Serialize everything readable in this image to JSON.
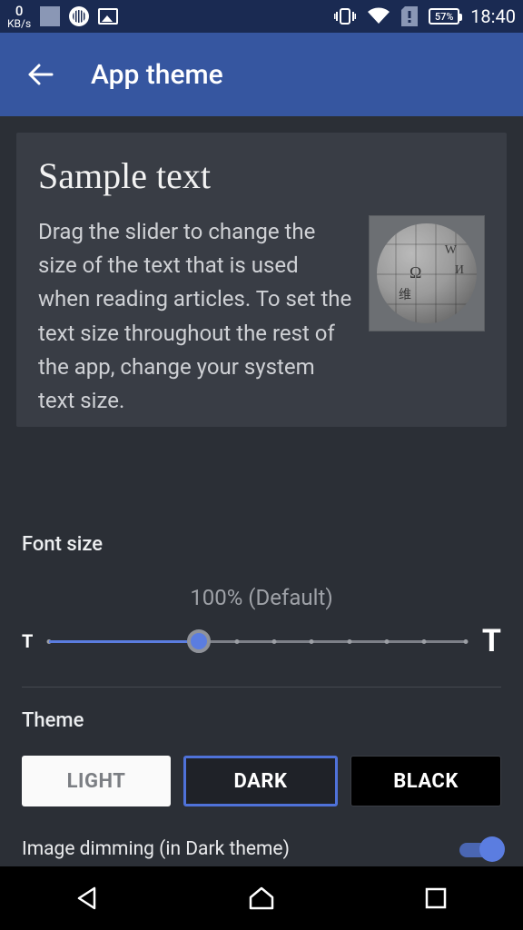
{
  "statusbar": {
    "kbps_value": "0",
    "kbps_unit": "KB/s",
    "battery_pct": "57%",
    "time": "18:40"
  },
  "appbar": {
    "title": "App theme"
  },
  "preview": {
    "heading": "Sample text",
    "body": "Drag the slider to change the size of the text that is used when reading articles. To set the text size throughout the rest of the app, change your system text size."
  },
  "font_size": {
    "label": "Font size",
    "value_label": "100% (Default)",
    "small_marker": "T",
    "large_marker": "T",
    "percent": 36
  },
  "theme": {
    "label": "Theme",
    "options": {
      "light": "LIGHT",
      "dark": "DARK",
      "black": "BLACK"
    },
    "selected": "dark"
  },
  "image_dimming": {
    "label": "Image dimming (in Dark theme)",
    "enabled": true
  },
  "globe_letters": [
    "W",
    "Ω",
    "И",
    "维"
  ]
}
